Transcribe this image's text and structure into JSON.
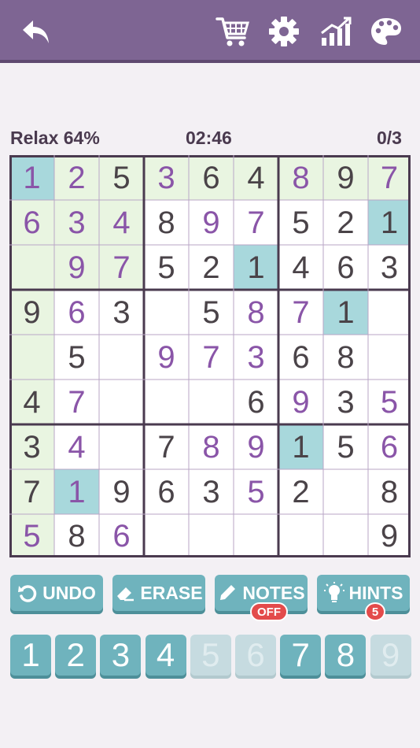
{
  "toolbar": {
    "icons": [
      "back-arrow-icon",
      "cart-icon",
      "gear-icon",
      "stats-chart-icon",
      "palette-icon"
    ]
  },
  "status": {
    "difficulty": "Relax 64%",
    "timer": "02:46",
    "mistakes": "0/3"
  },
  "board": {
    "cells": [
      [
        {
          "v": "1",
          "t": "entered",
          "h": "teal"
        },
        {
          "v": "2",
          "t": "entered",
          "h": "green"
        },
        {
          "v": "5",
          "t": "given",
          "h": "green"
        },
        {
          "v": "3",
          "t": "entered",
          "h": "green"
        },
        {
          "v": "6",
          "t": "given",
          "h": "green"
        },
        {
          "v": "4",
          "t": "given",
          "h": "green"
        },
        {
          "v": "8",
          "t": "entered",
          "h": "green"
        },
        {
          "v": "9",
          "t": "given",
          "h": "green"
        },
        {
          "v": "7",
          "t": "entered",
          "h": "green"
        }
      ],
      [
        {
          "v": "6",
          "t": "entered",
          "h": "green"
        },
        {
          "v": "3",
          "t": "entered",
          "h": "green"
        },
        {
          "v": "4",
          "t": "entered",
          "h": "green"
        },
        {
          "v": "8",
          "t": "given",
          "h": ""
        },
        {
          "v": "9",
          "t": "entered",
          "h": ""
        },
        {
          "v": "7",
          "t": "entered",
          "h": ""
        },
        {
          "v": "5",
          "t": "given",
          "h": ""
        },
        {
          "v": "2",
          "t": "given",
          "h": ""
        },
        {
          "v": "1",
          "t": "given",
          "h": "teal"
        }
      ],
      [
        {
          "v": "",
          "t": "",
          "h": "green"
        },
        {
          "v": "9",
          "t": "entered",
          "h": "green"
        },
        {
          "v": "7",
          "t": "entered",
          "h": "green"
        },
        {
          "v": "5",
          "t": "given",
          "h": ""
        },
        {
          "v": "2",
          "t": "given",
          "h": ""
        },
        {
          "v": "1",
          "t": "given",
          "h": "teal"
        },
        {
          "v": "4",
          "t": "given",
          "h": ""
        },
        {
          "v": "6",
          "t": "given",
          "h": ""
        },
        {
          "v": "3",
          "t": "given",
          "h": ""
        }
      ],
      [
        {
          "v": "9",
          "t": "given",
          "h": "green"
        },
        {
          "v": "6",
          "t": "entered",
          "h": ""
        },
        {
          "v": "3",
          "t": "given",
          "h": ""
        },
        {
          "v": "",
          "t": "",
          "h": ""
        },
        {
          "v": "5",
          "t": "given",
          "h": ""
        },
        {
          "v": "8",
          "t": "entered",
          "h": ""
        },
        {
          "v": "7",
          "t": "entered",
          "h": ""
        },
        {
          "v": "1",
          "t": "given",
          "h": "teal"
        },
        {
          "v": "",
          "t": "",
          "h": ""
        }
      ],
      [
        {
          "v": "",
          "t": "",
          "h": "green"
        },
        {
          "v": "5",
          "t": "given",
          "h": ""
        },
        {
          "v": "",
          "t": "",
          "h": ""
        },
        {
          "v": "9",
          "t": "entered",
          "h": ""
        },
        {
          "v": "7",
          "t": "entered",
          "h": ""
        },
        {
          "v": "3",
          "t": "entered",
          "h": ""
        },
        {
          "v": "6",
          "t": "given",
          "h": ""
        },
        {
          "v": "8",
          "t": "given",
          "h": ""
        },
        {
          "v": "",
          "t": "",
          "h": ""
        }
      ],
      [
        {
          "v": "4",
          "t": "given",
          "h": "green"
        },
        {
          "v": "7",
          "t": "entered",
          "h": ""
        },
        {
          "v": "",
          "t": "",
          "h": ""
        },
        {
          "v": "",
          "t": "",
          "h": ""
        },
        {
          "v": "",
          "t": "",
          "h": ""
        },
        {
          "v": "6",
          "t": "given",
          "h": ""
        },
        {
          "v": "9",
          "t": "entered",
          "h": ""
        },
        {
          "v": "3",
          "t": "given",
          "h": ""
        },
        {
          "v": "5",
          "t": "entered",
          "h": ""
        }
      ],
      [
        {
          "v": "3",
          "t": "given",
          "h": "green"
        },
        {
          "v": "4",
          "t": "entered",
          "h": ""
        },
        {
          "v": "",
          "t": "",
          "h": ""
        },
        {
          "v": "7",
          "t": "given",
          "h": ""
        },
        {
          "v": "8",
          "t": "entered",
          "h": ""
        },
        {
          "v": "9",
          "t": "entered",
          "h": ""
        },
        {
          "v": "1",
          "t": "given",
          "h": "teal"
        },
        {
          "v": "5",
          "t": "given",
          "h": ""
        },
        {
          "v": "6",
          "t": "entered",
          "h": ""
        }
      ],
      [
        {
          "v": "7",
          "t": "given",
          "h": "green"
        },
        {
          "v": "1",
          "t": "entered",
          "h": "teal"
        },
        {
          "v": "9",
          "t": "given",
          "h": ""
        },
        {
          "v": "6",
          "t": "given",
          "h": ""
        },
        {
          "v": "3",
          "t": "given",
          "h": ""
        },
        {
          "v": "5",
          "t": "entered",
          "h": ""
        },
        {
          "v": "2",
          "t": "given",
          "h": ""
        },
        {
          "v": "",
          "t": "",
          "h": ""
        },
        {
          "v": "8",
          "t": "given",
          "h": ""
        }
      ],
      [
        {
          "v": "5",
          "t": "entered",
          "h": "green"
        },
        {
          "v": "8",
          "t": "given",
          "h": ""
        },
        {
          "v": "6",
          "t": "entered",
          "h": ""
        },
        {
          "v": "",
          "t": "",
          "h": ""
        },
        {
          "v": "",
          "t": "",
          "h": ""
        },
        {
          "v": "",
          "t": "",
          "h": ""
        },
        {
          "v": "",
          "t": "",
          "h": ""
        },
        {
          "v": "",
          "t": "",
          "h": ""
        },
        {
          "v": "9",
          "t": "given",
          "h": ""
        }
      ]
    ]
  },
  "actions": {
    "undo": "UNDO",
    "erase": "ERASE",
    "notes": "NOTES",
    "notes_state": "OFF",
    "hints": "HINTS",
    "hints_count": "5"
  },
  "numpad": [
    {
      "label": "1",
      "enabled": true
    },
    {
      "label": "2",
      "enabled": true
    },
    {
      "label": "3",
      "enabled": true
    },
    {
      "label": "4",
      "enabled": true
    },
    {
      "label": "5",
      "enabled": false
    },
    {
      "label": "6",
      "enabled": false
    },
    {
      "label": "7",
      "enabled": true
    },
    {
      "label": "8",
      "enabled": true
    },
    {
      "label": "9",
      "enabled": false
    }
  ],
  "colors": {
    "header": "#7e6593",
    "highlight_teal": "#a8d8dc",
    "highlight_green": "#e9f5e1",
    "entered_digit": "#8a55a8",
    "given_digit": "#4a4348",
    "button": "#6fb3bd",
    "badge": "#e34b4b"
  }
}
